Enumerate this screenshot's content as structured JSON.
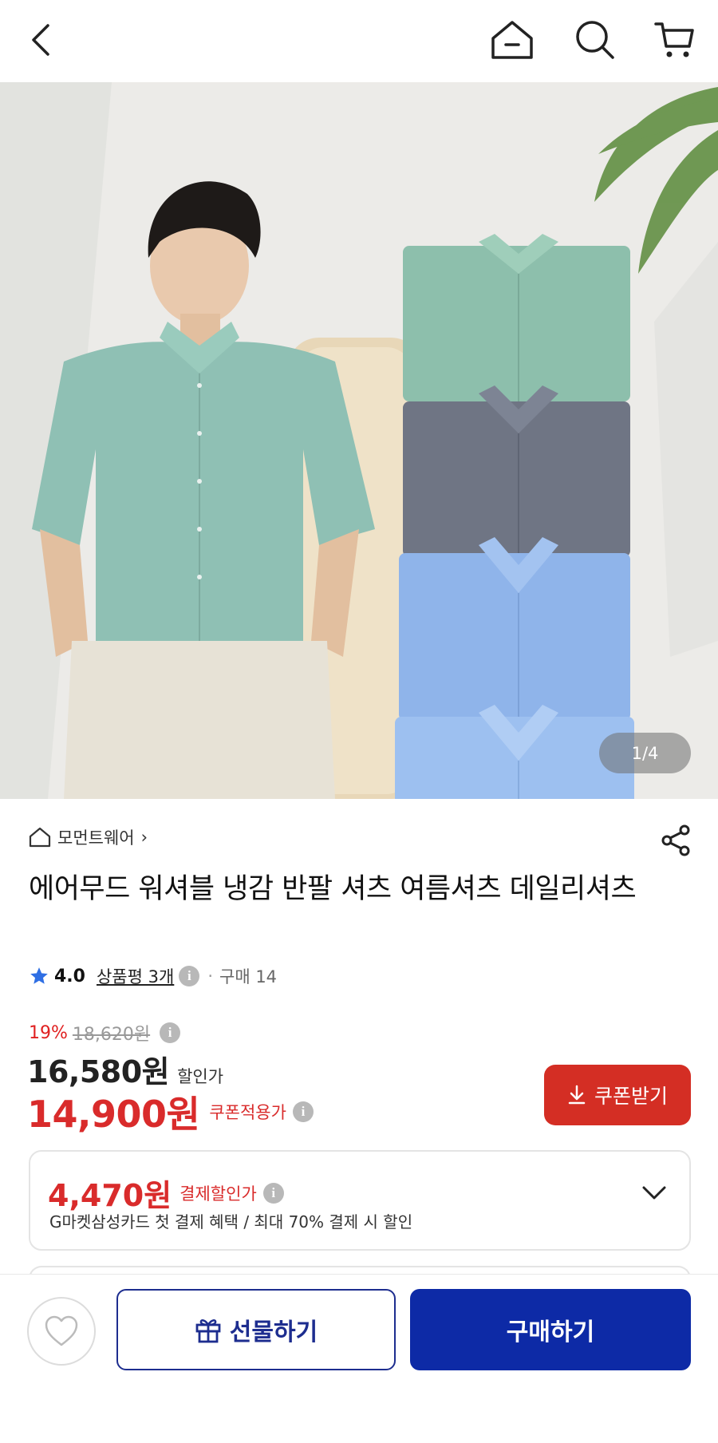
{
  "hero": {
    "counter": "1/4"
  },
  "product": {
    "brand": "모먼트웨어",
    "brand_chevron": "›",
    "title": "에어무드 워셔블 냉감 반팔 셔츠 여름셔츠 데일리셔츠",
    "rating": "4.0",
    "review_count": "상품평 3개",
    "purchase_count": "구매 14"
  },
  "pricing": {
    "discount_rate": "19%",
    "original_price": "18,620원",
    "sale_price": "16,580원",
    "sale_label": "할인가",
    "coupon_price": "14,900원",
    "coupon_label": "쿠폰적용가",
    "coupon_button": "쿠폰받기"
  },
  "payment_benefit": {
    "price": "4,470원",
    "label": "결제할인가",
    "description": "G마켓삼성카드 첫 결제 혜택 / 최대 70% 결제 시 할인"
  },
  "bottom_bar": {
    "gift_label": "선물하기",
    "buy_label": "구매하기"
  },
  "colors": {
    "accent_red": "#d92b2b",
    "primary_blue": "#0d2aa6"
  }
}
